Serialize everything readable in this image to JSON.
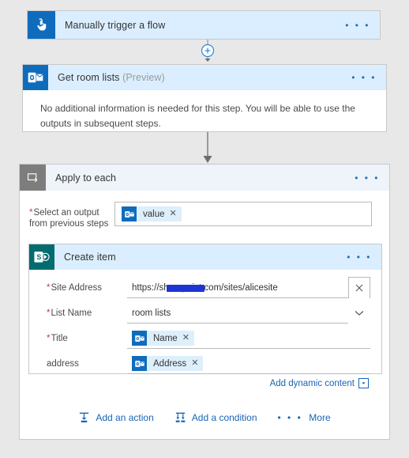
{
  "trigger": {
    "title": "Manually trigger a flow",
    "icon": "tap-hand-icon",
    "menu": "• • •"
  },
  "get_room_lists": {
    "title": "Get room lists",
    "preview_tag": "(Preview)",
    "icon": "outlook-icon",
    "body_text": "No additional information is needed for this step. You will be able to use the outputs in subsequent steps.",
    "menu": "• • •"
  },
  "apply_to_each": {
    "title": "Apply to each",
    "icon": "loop-icon",
    "menu": "• • •",
    "select_output": {
      "label_line1": "Select an output",
      "label_line2": "from previous steps",
      "required": true,
      "token": {
        "text": "value",
        "icon": "outlook-icon",
        "remove": "✕"
      }
    }
  },
  "create_item": {
    "title": "Create item",
    "icon": "sharepoint-icon",
    "menu": "• • •",
    "fields": [
      {
        "label": "Site Address",
        "required": true,
        "type": "text",
        "value": "https://█████sharepoint.com/sites/alicesite",
        "value_prefix": "https://",
        "value_suffix": "sharepoint.com/sites/alicesite",
        "redacted": true,
        "button": "clear-icon"
      },
      {
        "label": "List Name",
        "required": true,
        "type": "dropdown",
        "value": "room lists",
        "button": "chevron-down-icon"
      },
      {
        "label": "Title",
        "required": true,
        "type": "token",
        "token": {
          "text": "Name",
          "icon": "outlook-icon",
          "remove": "✕"
        }
      },
      {
        "label": "address",
        "required": false,
        "type": "token",
        "token": {
          "text": "Address",
          "icon": "outlook-icon",
          "remove": "✕"
        }
      }
    ],
    "add_dynamic_content": {
      "label": "Add dynamic content",
      "button_glyph": "▪"
    }
  },
  "footer_actions": {
    "add_action": {
      "label": "Add an action",
      "icon": "add-action-icon"
    },
    "add_condition": {
      "label": "Add a condition",
      "icon": "add-condition-icon"
    },
    "more": {
      "label": "More",
      "dots": "• • •"
    }
  },
  "colors": {
    "accent_blue": "#0f6cbd",
    "header_blue": "#dbeeff",
    "link_blue": "#1865b5",
    "required_red": "#c73b3b",
    "canvas_gray": "#e8e8e8",
    "loop_gray": "#7d7d7d",
    "redaction": "#1d35d4"
  }
}
